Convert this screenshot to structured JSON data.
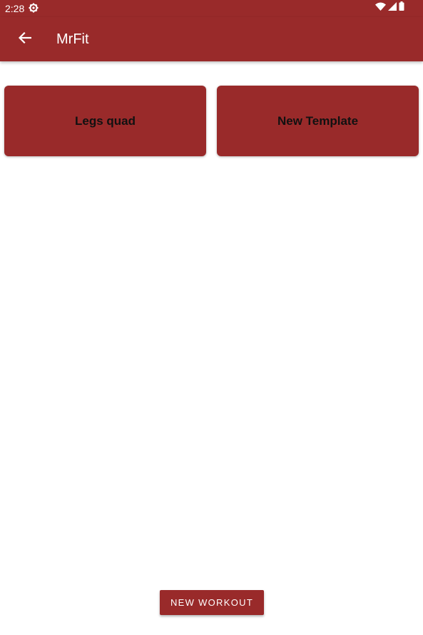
{
  "status_bar": {
    "time": "2:28",
    "icons": [
      "settings-icon",
      "wifi-icon",
      "signal-icon",
      "battery-icon"
    ]
  },
  "app_bar": {
    "title": "MrFit",
    "back_icon": "arrow-back-icon"
  },
  "templates": [
    {
      "label": "Legs quad"
    },
    {
      "label": "New Template"
    }
  ],
  "actions": {
    "new_workout_label": "NEW WORKOUT"
  },
  "colors": {
    "primary": "#992a2a",
    "background": "#ffffff",
    "card_text": "#111111",
    "on_primary": "#ffffff"
  }
}
